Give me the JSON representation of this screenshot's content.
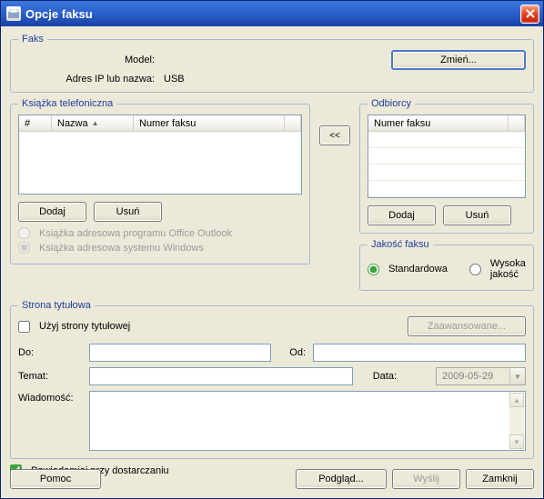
{
  "titlebar": {
    "title": "Opcje faksu"
  },
  "fax": {
    "legend": "Faks",
    "model_label": "Model:",
    "model_value": "",
    "addr_label": "Adres IP lub nazwa:",
    "addr_value": "USB",
    "change_btn": "Zmień..."
  },
  "phonebook": {
    "legend": "Książka telefoniczna",
    "col_num": "#",
    "col_name": "Nazwa",
    "col_fax": "Numer faksu",
    "add_btn": "Dodaj",
    "del_btn": "Usuń",
    "opt_outlook": "Książka adresowa programu Office Outlook",
    "opt_windows": "Książka adresowa systemu Windows"
  },
  "move_btn": "<<",
  "recipients": {
    "legend": "Odbiorcy",
    "col_fax": "Numer faksu",
    "add_btn": "Dodaj",
    "del_btn": "Usuń"
  },
  "quality": {
    "legend": "Jakość faksu",
    "std": "Standardowa",
    "high": "Wysoka jakość"
  },
  "cover": {
    "legend": "Strona tytułowa",
    "use_cover": "Użyj strony tytułowej",
    "advanced": "Zaawansowane...",
    "to": "Do:",
    "from": "Od:",
    "subject": "Temat:",
    "date": "Data:",
    "date_value": "2009-05-29",
    "message": "Wiadomość:"
  },
  "notify": "Powiadamiaj przy dostarczaniu",
  "buttons": {
    "help": "Pomoc",
    "preview": "Podgląd...",
    "send": "Wyślij",
    "close": "Zamknij"
  }
}
